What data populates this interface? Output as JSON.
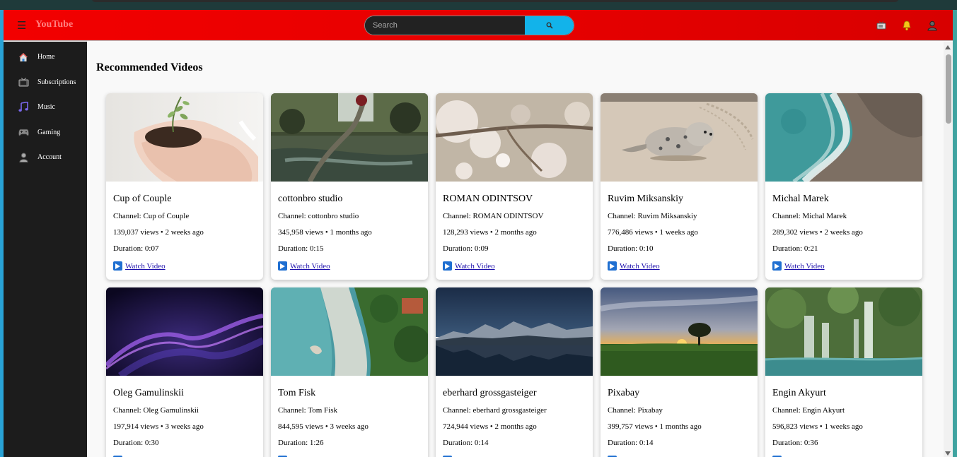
{
  "app": {
    "title": "YouTube"
  },
  "header": {
    "menu_glyph": "☰",
    "search_placeholder": "Search",
    "search_icon": "search-icon",
    "icons": [
      "tv-icon",
      "bell-icon",
      "user-icon"
    ]
  },
  "sidebar": {
    "items": [
      {
        "label": "Home",
        "icon": "home-icon"
      },
      {
        "label": "Subscriptions",
        "icon": "tv-icon"
      },
      {
        "label": "Music",
        "icon": "music-note-icon"
      },
      {
        "label": "Gaming",
        "icon": "game-controller-icon"
      },
      {
        "label": "Account",
        "icon": "user-icon"
      }
    ]
  },
  "main": {
    "title": "Recommended Videos",
    "watch_label": "Watch Video",
    "videos": [
      {
        "title": "Cup of Couple",
        "channel": "Channel: Cup of Couple",
        "stats": "139,037 views • 2 weeks ago",
        "duration": "Duration: 0:07",
        "thumb": "hands-holding-soil-plant"
      },
      {
        "title": "cottonbro studio",
        "channel": "Channel: cottonbro studio",
        "stats": "345,958 views • 1 months ago",
        "duration": "Duration: 0:15",
        "thumb": "forest-stream"
      },
      {
        "title": "ROMAN ODINTSOV",
        "channel": "Channel: ROMAN ODINTSOV",
        "stats": "128,293 views • 2 months ago",
        "duration": "Duration: 0:09",
        "thumb": "cherry-blossom"
      },
      {
        "title": "Ruvim Miksanskiy",
        "channel": "Channel: Ruvim Miksanskiy",
        "stats": "776,486 views • 1 weeks ago",
        "duration": "Duration: 0:10",
        "thumb": "seal-on-beach"
      },
      {
        "title": "Michal Marek",
        "channel": "Channel: Michal Marek",
        "stats": "289,302 views • 2 weeks ago",
        "duration": "Duration: 0:21",
        "thumb": "aerial-coast"
      },
      {
        "title": "Oleg Gamulinskii",
        "channel": "Channel: Oleg Gamulinskii",
        "stats": "197,914 views • 3 weeks ago",
        "duration": "Duration: 0:30",
        "thumb": "purple-particles"
      },
      {
        "title": "Tom Fisk",
        "channel": "Channel: Tom Fisk",
        "stats": "844,595 views • 3 weeks ago",
        "duration": "Duration: 1:26",
        "thumb": "aerial-beach"
      },
      {
        "title": "eberhard grossgasteiger",
        "channel": "Channel: eberhard grossgasteiger",
        "stats": "724,944 views • 2 months ago",
        "duration": "Duration: 0:14",
        "thumb": "mountain-lake-night"
      },
      {
        "title": "Pixabay",
        "channel": "Channel: Pixabay",
        "stats": "399,757 views • 1 months ago",
        "duration": "Duration: 0:14",
        "thumb": "sunset-field-tree"
      },
      {
        "title": "Engin Akyurt",
        "channel": "Channel: Engin Akyurt",
        "stats": "596,823 views • 1 weeks ago",
        "duration": "Duration: 0:36",
        "thumb": "waterfall"
      }
    ]
  },
  "colors": {
    "header_red": "#e80000",
    "sidebar_bg": "#1c1c1c",
    "search_button": "#12b3ea",
    "link": "#1a0dab"
  }
}
